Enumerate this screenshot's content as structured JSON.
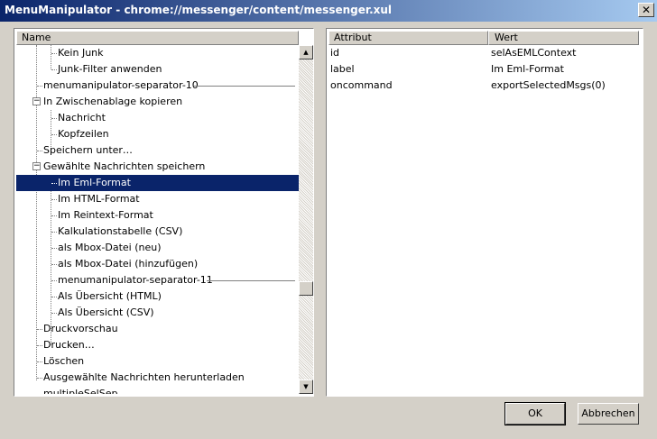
{
  "window": {
    "title": "MenuManipulator - chrome://messenger/content/messenger.xul",
    "close_glyph": "✕"
  },
  "tree": {
    "column": "Name",
    "rows": [
      {
        "label": "Kein Junk"
      },
      {
        "label": "Junk-Filter anwenden"
      },
      {
        "label": "menumanipulator-separator-10"
      },
      {
        "label": "In Zwischenablage kopieren",
        "twisty": "−"
      },
      {
        "label": "Nachricht"
      },
      {
        "label": "Kopfzeilen"
      },
      {
        "label": "Speichern unter…"
      },
      {
        "label": "Gewählte Nachrichten speichern",
        "twisty": "−"
      },
      {
        "label": "Im Eml-Format"
      },
      {
        "label": "Im HTML-Format"
      },
      {
        "label": "Im Reintext-Format"
      },
      {
        "label": "Kalkulationstabelle (CSV)"
      },
      {
        "label": "als Mbox-Datei (neu)"
      },
      {
        "label": "als Mbox-Datei (hinzufügen)"
      },
      {
        "label": "menumanipulator-separator-11"
      },
      {
        "label": "Als Übersicht (HTML)"
      },
      {
        "label": "Als Übersicht (CSV)"
      },
      {
        "label": "Druckvorschau"
      },
      {
        "label": "Drucken…"
      },
      {
        "label": "Löschen"
      },
      {
        "label": "Ausgewählte Nachrichten herunterladen"
      },
      {
        "label": "multipleSelSep"
      }
    ]
  },
  "scrollbar": {
    "up_glyph": "▲",
    "down_glyph": "▼"
  },
  "attributes": {
    "columns": [
      "Attribut",
      "Wert"
    ],
    "rows": [
      {
        "name": "id",
        "value": "selAsEMLContext"
      },
      {
        "name": "label",
        "value": "Im Eml-Format"
      },
      {
        "name": "oncommand",
        "value": "exportSelectedMsgs(0)"
      }
    ]
  },
  "buttons": {
    "ok": "OK",
    "cancel": "Abbrechen"
  }
}
